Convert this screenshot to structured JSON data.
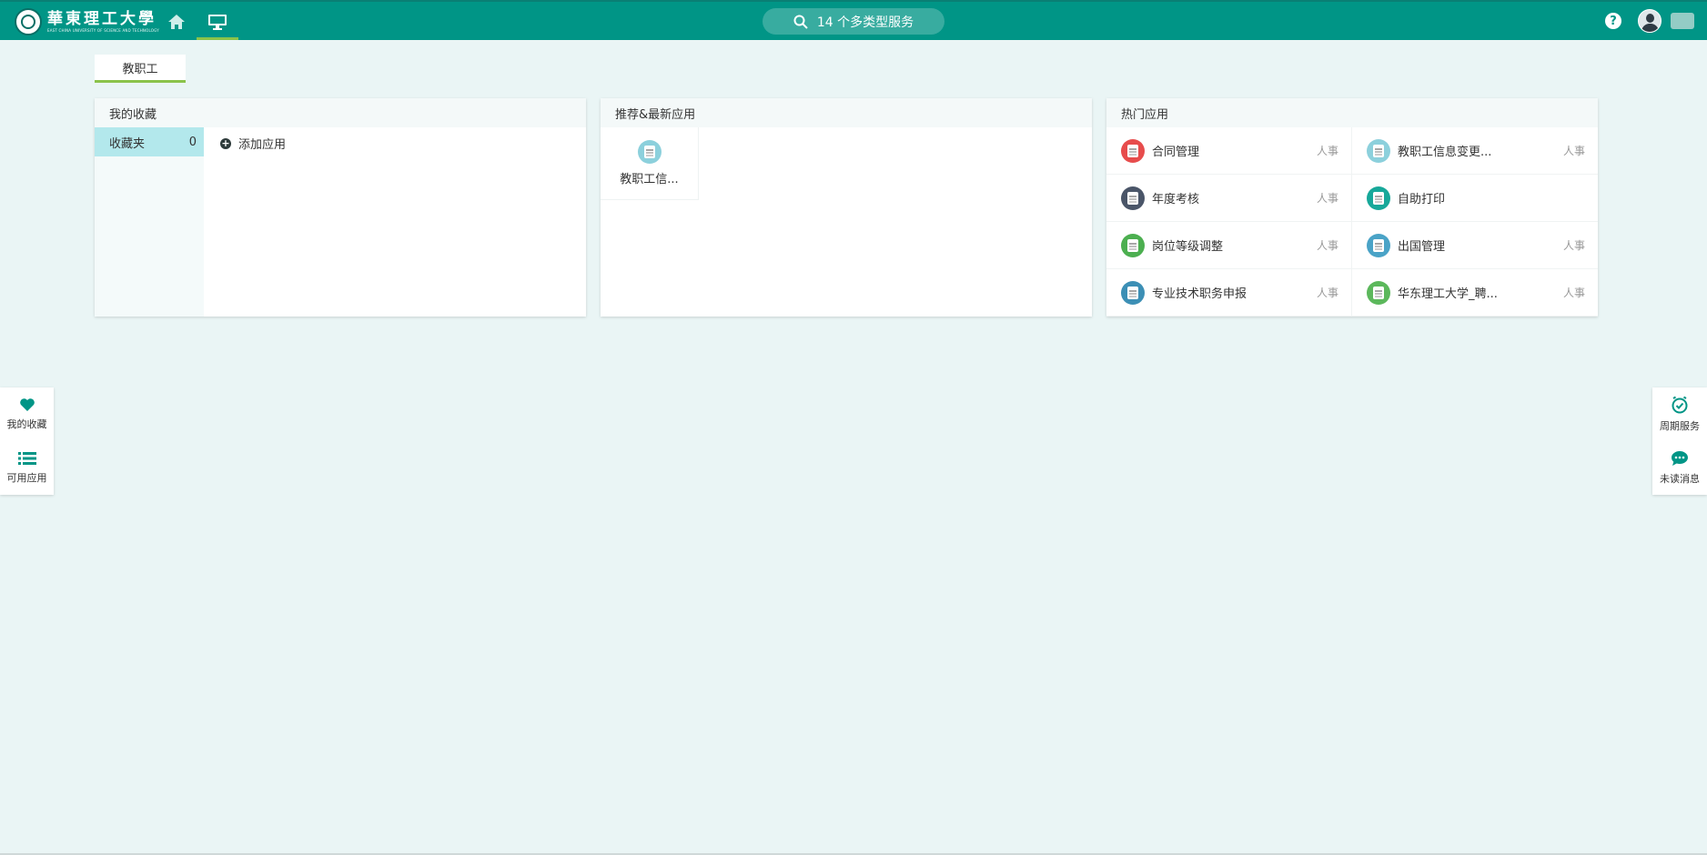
{
  "header": {
    "logo_cn": "華東理工大學",
    "logo_en": "EAST CHINA UNIVERSITY OF SCIENCE AND TECHNOLOGY",
    "search_label": "14 个多类型服务",
    "help_label": "?"
  },
  "role_tab": {
    "label": "教职工"
  },
  "favorites": {
    "title": "我的收藏",
    "folder_label": "收藏夹",
    "folder_count": "0",
    "add_app_label": "添加应用"
  },
  "recommended": {
    "title": "推荐&最新应用",
    "items": [
      {
        "label": "教职工信...",
        "icon": "staff-info-icon"
      }
    ]
  },
  "hot_apps": {
    "title": "热门应用",
    "items": [
      {
        "name": "合同管理",
        "tag": "人事",
        "icon": "contract-icon",
        "color": "#e74c4c"
      },
      {
        "name": "教职工信息变更...",
        "tag": "人事",
        "icon": "staff-info-change-icon",
        "color": "#8cd0dc"
      },
      {
        "name": "年度考核",
        "tag": "人事",
        "icon": "annual-review-icon",
        "color": "#4a5568"
      },
      {
        "name": "自助打印",
        "tag": "",
        "icon": "print-icon",
        "color": "#17a89a"
      },
      {
        "name": "岗位等级调整",
        "tag": "人事",
        "icon": "position-adjust-icon",
        "color": "#4caf50"
      },
      {
        "name": "出国管理",
        "tag": "人事",
        "icon": "travel-abroad-icon",
        "color": "#4aa3c7"
      },
      {
        "name": "专业技术职务申报",
        "tag": "人事",
        "icon": "title-apply-icon",
        "color": "#3c8fb5"
      },
      {
        "name": "华东理工大学_聘...",
        "tag": "人事",
        "icon": "recruit-icon",
        "color": "#5cb85c"
      }
    ]
  },
  "left_float": {
    "favorites_label": "我的收藏",
    "apps_label": "可用应用"
  },
  "right_float": {
    "periodic_label": "周期服务",
    "messages_label": "未读消息"
  },
  "colors": {
    "primary": "#009586",
    "accent": "#8bc34a",
    "background": "#eaf5f5"
  }
}
